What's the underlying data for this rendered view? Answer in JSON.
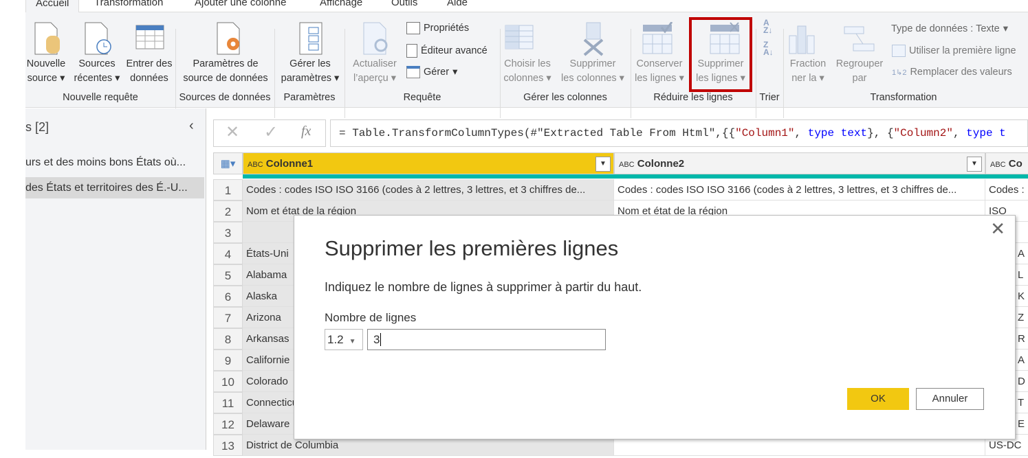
{
  "tabs": [
    "Accueil",
    "Transformation",
    "Ajouter une colonne",
    "Affichage",
    "Outils",
    "Aide"
  ],
  "ribbon": {
    "new_source": [
      "Nouvelle",
      "source"
    ],
    "recent_sources": [
      "Sources",
      "récentes"
    ],
    "enter_data": [
      "Entrer des",
      "données"
    ],
    "ds_settings": [
      "Paramètres de",
      "source de données"
    ],
    "manage_params": [
      "Gérer les",
      "paramètres"
    ],
    "refresh": [
      "Actualiser",
      "l’aperçu"
    ],
    "properties": "Propriétés",
    "advanced_editor": "Éditeur avancé",
    "manage": "Gérer",
    "choose_cols": [
      "Choisir les",
      "colonnes"
    ],
    "remove_cols": [
      "Supprimer",
      "les colonnes"
    ],
    "keep_rows": [
      "Conserver",
      "les lignes"
    ],
    "remove_rows": [
      "Supprimer",
      "les lignes"
    ],
    "split": [
      "Fraction",
      "ner la"
    ],
    "group_by": [
      "Regrouper",
      "par"
    ],
    "data_type": "Type de données : Texte",
    "use_first_row": "Utiliser la première ligne",
    "replace_values": "Remplacer des valeurs",
    "groups": [
      "Nouvelle requête",
      "Sources de données",
      "Paramètres",
      "Requête",
      "Gérer les colonnes",
      "Réduire les lignes",
      "Trier",
      "Transformation"
    ],
    "highlight_color": "#c00000"
  },
  "queries": {
    "title": "s [2]",
    "items": [
      "urs et des moins bons États où...",
      "des États et territoires des É.-U..."
    ]
  },
  "formula": {
    "prefix": "= Table.TransformColumnTypes(#\"Extracted Table From Html\",{{",
    "s1": "\"Column1\"",
    ", ": ", ",
    "t1": "type text",
    "mid": "}, {",
    "s2": "\"Column2\"",
    "t2": "type t"
  },
  "grid": {
    "columns": [
      "Colonne1",
      "Colonne2",
      "Co"
    ],
    "type_badge": "ABC",
    "rows": [
      {
        "n": "1",
        "c1": "Codes :    codes ISO ISO 3166 (codes à 2 lettres, 3 lettres, et 3 chiffres de...",
        "c2": "Codes :    codes ISO ISO 3166 (codes à 2 lettres, 3 lettres, et 3 chiffres de...",
        "c3": "Codes :"
      },
      {
        "n": "2",
        "c1": "Nom et état de la région",
        "c2": "Nom et état de la région",
        "c3": "ISO"
      },
      {
        "n": "3",
        "c1": "",
        "c2": "",
        "c3": ""
      },
      {
        "n": "4",
        "c1": "États-Uni",
        "c2": "",
        "c3": "A"
      },
      {
        "n": "5",
        "c1": "Alabama",
        "c2": "",
        "c3": "L"
      },
      {
        "n": "6",
        "c1": "Alaska",
        "c2": "",
        "c3": "K"
      },
      {
        "n": "7",
        "c1": "Arizona",
        "c2": "",
        "c3": "Z"
      },
      {
        "n": "8",
        "c1": "Arkansas",
        "c2": "",
        "c3": "R"
      },
      {
        "n": "9",
        "c1": "Californie",
        "c2": "",
        "c3": "A"
      },
      {
        "n": "10",
        "c1": "Colorado",
        "c2": "",
        "c3": "D"
      },
      {
        "n": "11",
        "c1": "Connecticut",
        "c2": "",
        "c3": "T"
      },
      {
        "n": "12",
        "c1": "Delaware",
        "c2": "",
        "c3": "E"
      },
      {
        "n": "13",
        "c1": "District de Columbia",
        "c2": "",
        "c3": "US-DC"
      }
    ],
    "selected_header_color": "#f2c811",
    "quality_bar_color": "#01b8aa"
  },
  "dialog": {
    "title": "Supprimer les premières lignes",
    "description": "Indiquez le nombre de lignes à supprimer à partir du haut.",
    "field_label": "Nombre de lignes",
    "type_select": "1.2",
    "value": "3",
    "ok": "OK",
    "cancel": "Annuler",
    "accent": "#f2c811"
  }
}
